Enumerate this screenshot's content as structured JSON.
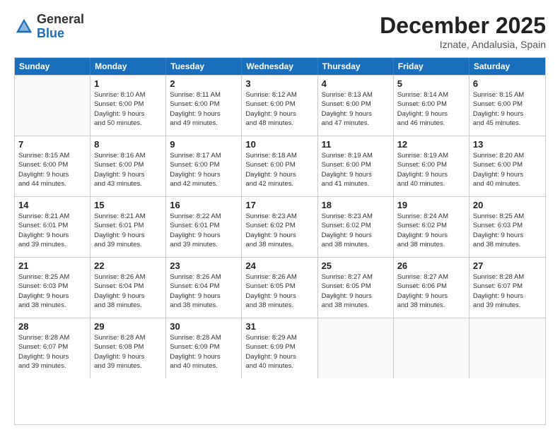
{
  "logo": {
    "general": "General",
    "blue": "Blue"
  },
  "title": "December 2025",
  "location": "Iznate, Andalusia, Spain",
  "header_days": [
    "Sunday",
    "Monday",
    "Tuesday",
    "Wednesday",
    "Thursday",
    "Friday",
    "Saturday"
  ],
  "weeks": [
    [
      {
        "day": "",
        "info": ""
      },
      {
        "day": "1",
        "info": "Sunrise: 8:10 AM\nSunset: 6:00 PM\nDaylight: 9 hours\nand 50 minutes."
      },
      {
        "day": "2",
        "info": "Sunrise: 8:11 AM\nSunset: 6:00 PM\nDaylight: 9 hours\nand 49 minutes."
      },
      {
        "day": "3",
        "info": "Sunrise: 8:12 AM\nSunset: 6:00 PM\nDaylight: 9 hours\nand 48 minutes."
      },
      {
        "day": "4",
        "info": "Sunrise: 8:13 AM\nSunset: 6:00 PM\nDaylight: 9 hours\nand 47 minutes."
      },
      {
        "day": "5",
        "info": "Sunrise: 8:14 AM\nSunset: 6:00 PM\nDaylight: 9 hours\nand 46 minutes."
      },
      {
        "day": "6",
        "info": "Sunrise: 8:15 AM\nSunset: 6:00 PM\nDaylight: 9 hours\nand 45 minutes."
      }
    ],
    [
      {
        "day": "7",
        "info": "Sunrise: 8:15 AM\nSunset: 6:00 PM\nDaylight: 9 hours\nand 44 minutes."
      },
      {
        "day": "8",
        "info": "Sunrise: 8:16 AM\nSunset: 6:00 PM\nDaylight: 9 hours\nand 43 minutes."
      },
      {
        "day": "9",
        "info": "Sunrise: 8:17 AM\nSunset: 6:00 PM\nDaylight: 9 hours\nand 42 minutes."
      },
      {
        "day": "10",
        "info": "Sunrise: 8:18 AM\nSunset: 6:00 PM\nDaylight: 9 hours\nand 42 minutes."
      },
      {
        "day": "11",
        "info": "Sunrise: 8:19 AM\nSunset: 6:00 PM\nDaylight: 9 hours\nand 41 minutes."
      },
      {
        "day": "12",
        "info": "Sunrise: 8:19 AM\nSunset: 6:00 PM\nDaylight: 9 hours\nand 40 minutes."
      },
      {
        "day": "13",
        "info": "Sunrise: 8:20 AM\nSunset: 6:00 PM\nDaylight: 9 hours\nand 40 minutes."
      }
    ],
    [
      {
        "day": "14",
        "info": "Sunrise: 8:21 AM\nSunset: 6:01 PM\nDaylight: 9 hours\nand 39 minutes."
      },
      {
        "day": "15",
        "info": "Sunrise: 8:21 AM\nSunset: 6:01 PM\nDaylight: 9 hours\nand 39 minutes."
      },
      {
        "day": "16",
        "info": "Sunrise: 8:22 AM\nSunset: 6:01 PM\nDaylight: 9 hours\nand 39 minutes."
      },
      {
        "day": "17",
        "info": "Sunrise: 8:23 AM\nSunset: 6:02 PM\nDaylight: 9 hours\nand 38 minutes."
      },
      {
        "day": "18",
        "info": "Sunrise: 8:23 AM\nSunset: 6:02 PM\nDaylight: 9 hours\nand 38 minutes."
      },
      {
        "day": "19",
        "info": "Sunrise: 8:24 AM\nSunset: 6:02 PM\nDaylight: 9 hours\nand 38 minutes."
      },
      {
        "day": "20",
        "info": "Sunrise: 8:25 AM\nSunset: 6:03 PM\nDaylight: 9 hours\nand 38 minutes."
      }
    ],
    [
      {
        "day": "21",
        "info": "Sunrise: 8:25 AM\nSunset: 6:03 PM\nDaylight: 9 hours\nand 38 minutes."
      },
      {
        "day": "22",
        "info": "Sunrise: 8:26 AM\nSunset: 6:04 PM\nDaylight: 9 hours\nand 38 minutes."
      },
      {
        "day": "23",
        "info": "Sunrise: 8:26 AM\nSunset: 6:04 PM\nDaylight: 9 hours\nand 38 minutes."
      },
      {
        "day": "24",
        "info": "Sunrise: 8:26 AM\nSunset: 6:05 PM\nDaylight: 9 hours\nand 38 minutes."
      },
      {
        "day": "25",
        "info": "Sunrise: 8:27 AM\nSunset: 6:05 PM\nDaylight: 9 hours\nand 38 minutes."
      },
      {
        "day": "26",
        "info": "Sunrise: 8:27 AM\nSunset: 6:06 PM\nDaylight: 9 hours\nand 38 minutes."
      },
      {
        "day": "27",
        "info": "Sunrise: 8:28 AM\nSunset: 6:07 PM\nDaylight: 9 hours\nand 39 minutes."
      }
    ],
    [
      {
        "day": "28",
        "info": "Sunrise: 8:28 AM\nSunset: 6:07 PM\nDaylight: 9 hours\nand 39 minutes."
      },
      {
        "day": "29",
        "info": "Sunrise: 8:28 AM\nSunset: 6:08 PM\nDaylight: 9 hours\nand 39 minutes."
      },
      {
        "day": "30",
        "info": "Sunrise: 8:28 AM\nSunset: 6:09 PM\nDaylight: 9 hours\nand 40 minutes."
      },
      {
        "day": "31",
        "info": "Sunrise: 8:29 AM\nSunset: 6:09 PM\nDaylight: 9 hours\nand 40 minutes."
      },
      {
        "day": "",
        "info": ""
      },
      {
        "day": "",
        "info": ""
      },
      {
        "day": "",
        "info": ""
      }
    ]
  ]
}
